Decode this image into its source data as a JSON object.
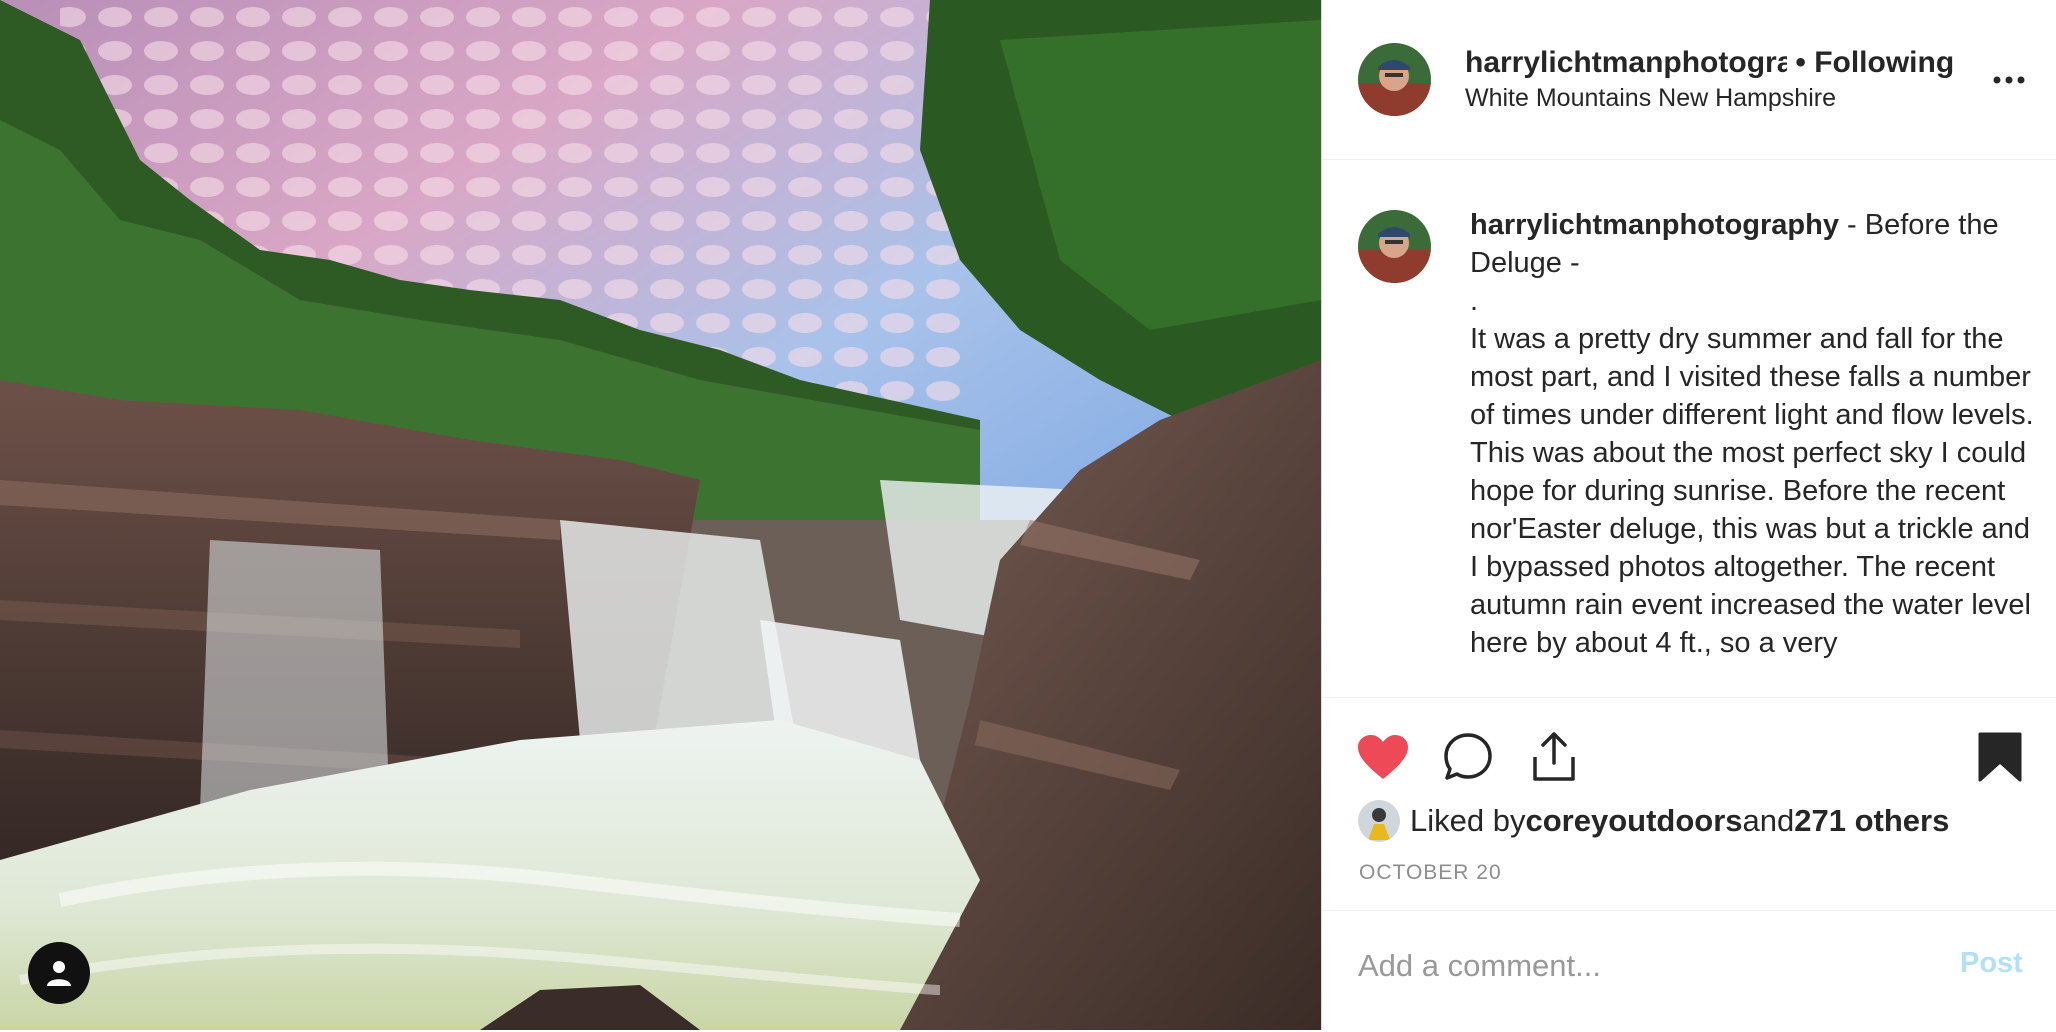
{
  "post": {
    "image_alt": "Waterfall cascading over granite ledges under a pink and blue mackerel sky",
    "tagged_user_icon": "person-icon"
  },
  "header": {
    "username": "harrylichtmanphotography",
    "separator": " • ",
    "follow_status": "Following",
    "location": "White Mountains New Hampshire",
    "more_icon": "more-horizontal-icon"
  },
  "caption": {
    "username": "harrylichtmanphotography",
    "title": " - Before the Deluge -",
    "dot": ".",
    "body": "It was a pretty dry summer and fall for the most part, and I visited these falls a number of times under different light and flow levels. This was about the most perfect sky I could hope for during sunrise. Before the recent nor'Easter deluge, this was but a trickle and I bypassed photos altogether. The recent autumn rain event increased the water level here by about 4 ft., so a very"
  },
  "actions": {
    "like_icon": "heart-filled-icon",
    "comment_icon": "comment-bubble-icon",
    "share_icon": "share-upload-icon",
    "save_icon": "bookmark-filled-icon",
    "like_color": "#ed4956"
  },
  "likes": {
    "prefix": "Liked by ",
    "liker": "coreyoutdoors",
    "conjunction": " and ",
    "others": "271 others"
  },
  "date": "OCTOBER 20",
  "comment": {
    "placeholder": "Add a comment...",
    "post_label": "Post"
  }
}
